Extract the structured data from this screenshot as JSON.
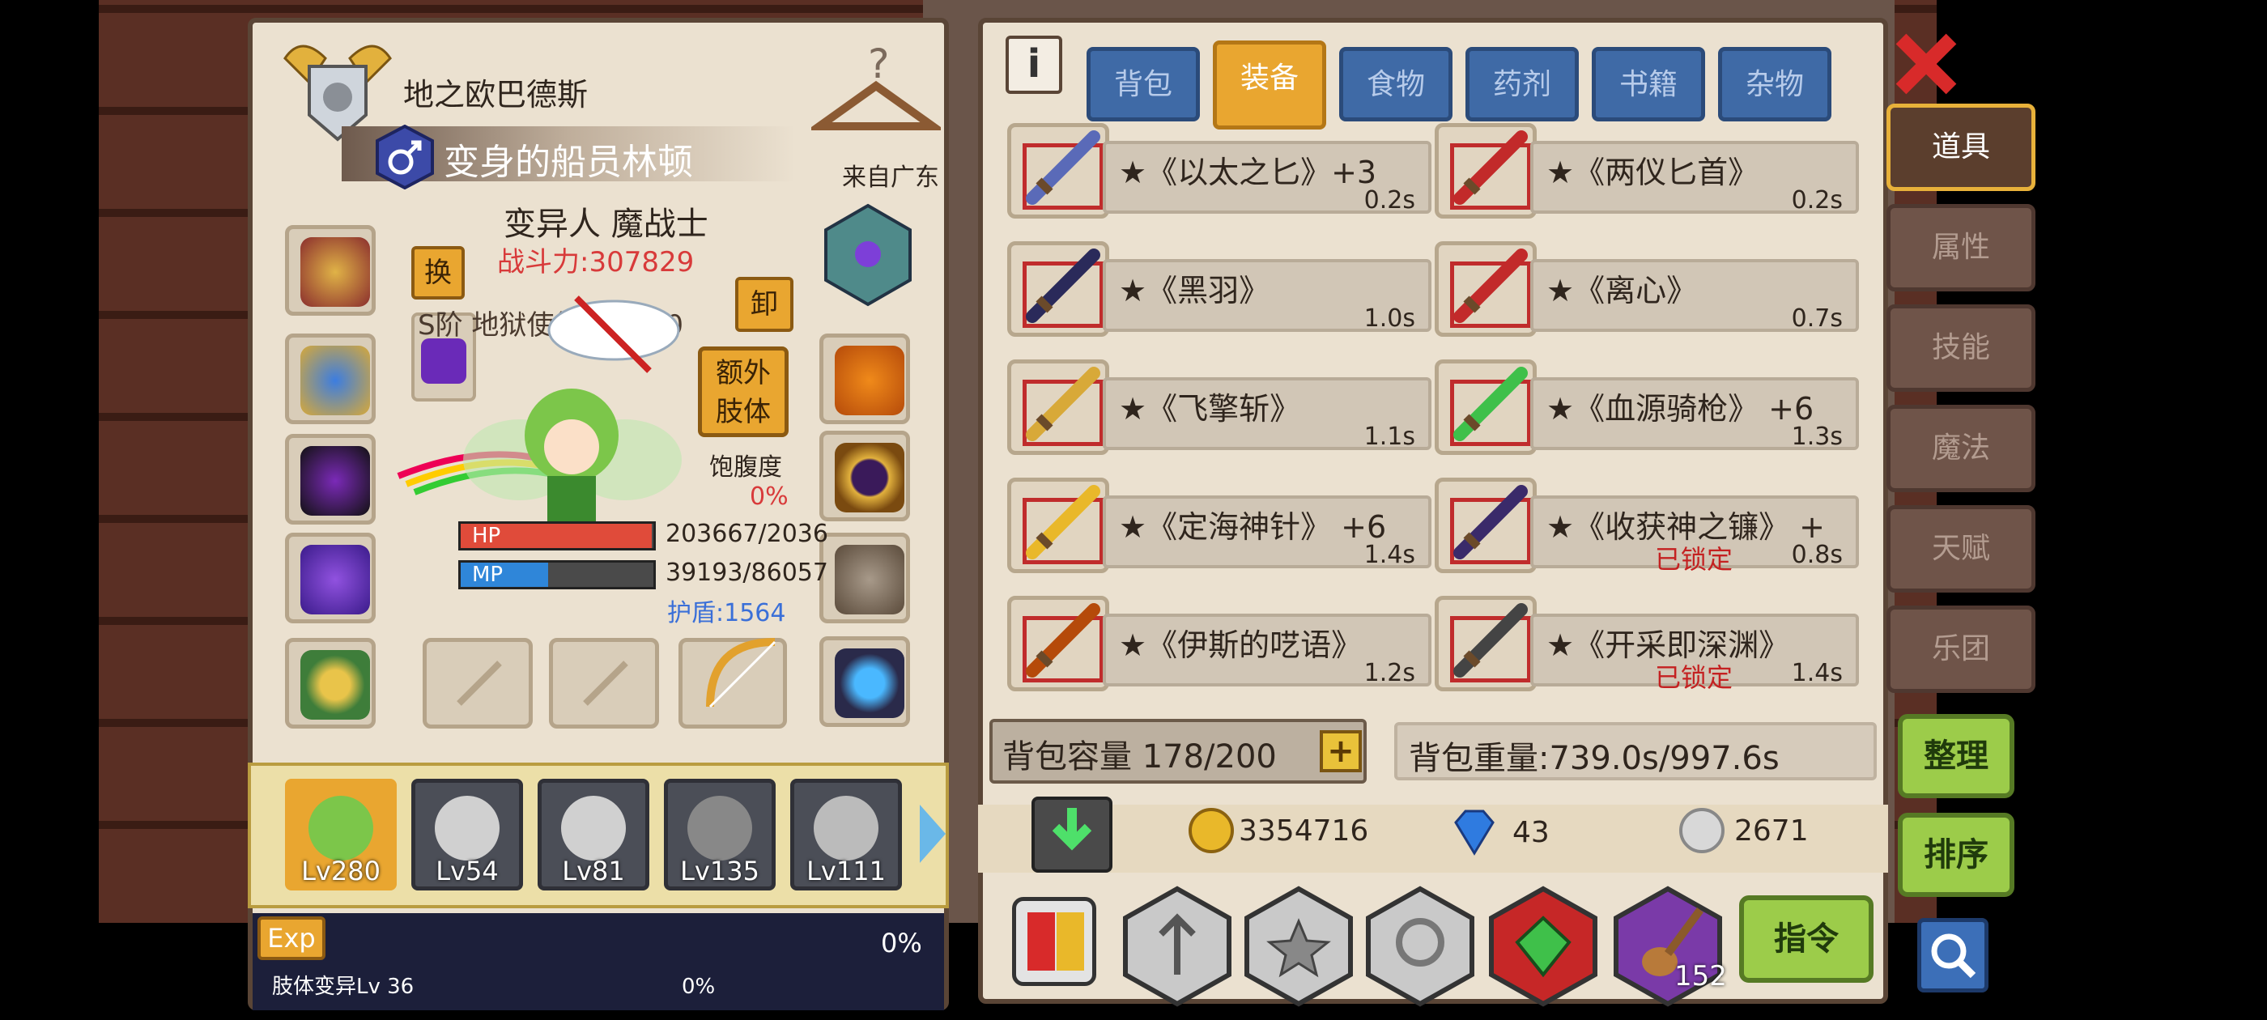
{
  "header": {
    "title": "地之欧巴德斯",
    "character_name": "变身的船员林顿",
    "origin": "来自广东",
    "class": "变异人 魔战士",
    "power": "战斗力:307829",
    "swap_label": "换",
    "unequip_label": "卸",
    "extra_limb_label": "额外肢体",
    "satiety_label": "饱腹度",
    "satiety_value": "0%",
    "rank_text": "S阶 地狱使徒 Lv 100"
  },
  "stats": {
    "hp_label": "HP",
    "hp_value": "203667/2036",
    "hp_fraction": 0.99,
    "mp_label": "MP",
    "mp_value": "39193/86057",
    "mp_fraction": 0.455,
    "shield": "护盾:1564"
  },
  "party": [
    {
      "level": "Lv280",
      "selected": true
    },
    {
      "level": "Lv54"
    },
    {
      "level": "Lv81"
    },
    {
      "level": "Lv135"
    },
    {
      "level": "Lv111"
    }
  ],
  "exp": {
    "label": "Exp",
    "percent": "0%",
    "limb_text": "肢体变异Lv 36",
    "limb_percent": "0%"
  },
  "tabs": [
    "背包",
    "装备",
    "食物",
    "药剂",
    "书籍",
    "杂物"
  ],
  "selected_tab": "装备",
  "side_tabs": [
    "道具",
    "属性",
    "技能",
    "魔法",
    "天赋",
    "乐团"
  ],
  "items": [
    {
      "name": "★《以太之匕》+3",
      "weight": "0.2s",
      "locked": ""
    },
    {
      "name": "★《两仪匕首》",
      "weight": "0.2s",
      "locked": ""
    },
    {
      "name": "★《黑羽》",
      "weight": "1.0s",
      "locked": ""
    },
    {
      "name": "★《离心》",
      "weight": "0.7s",
      "locked": ""
    },
    {
      "name": "★《飞擎斩》",
      "weight": "1.1s",
      "locked": ""
    },
    {
      "name": "★《血源骑枪》 +6",
      "weight": "1.3s",
      "locked": ""
    },
    {
      "name": "★《定海神针》 +6",
      "weight": "1.4s",
      "locked": ""
    },
    {
      "name": "★《收获神之镰》 +",
      "weight": "0.8s",
      "locked": "已锁定"
    },
    {
      "name": "★《伊斯的呓语》",
      "weight": "1.2s",
      "locked": ""
    },
    {
      "name": "★《开采即深渊》",
      "weight": "1.4s",
      "locked": "已锁定"
    }
  ],
  "capacity": {
    "label": "背包容量 178/200",
    "weight": "背包重量:739.0s/997.6s"
  },
  "currency": {
    "gold": "3354716",
    "gems": "43",
    "silver": "2671"
  },
  "buttons": {
    "organize": "整理",
    "sort": "排序",
    "command": "指令",
    "badge_count": "152"
  },
  "colors": {
    "hp": "#e04b3a",
    "mp": "#2f86d9",
    "power": "#d83a3a",
    "shield": "#3a6fd8",
    "locked": "#c42121",
    "tab_selected": "#e9a630",
    "tab": "#3f6aa6"
  }
}
